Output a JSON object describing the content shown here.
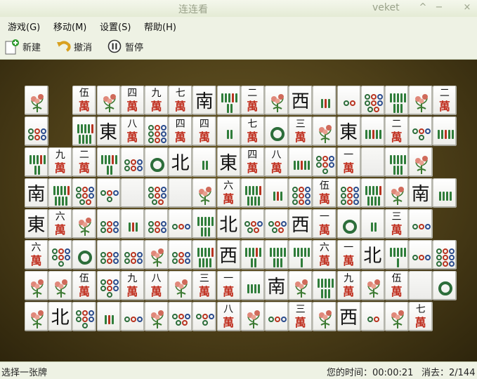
{
  "window": {
    "title": "连连看",
    "app": "veket",
    "buttons": [
      "^",
      "−",
      "×"
    ]
  },
  "menu": [
    "游戏(G)",
    "移动(M)",
    "设置(S)",
    "帮助(H)"
  ],
  "toolbar": {
    "new": "新建",
    "undo": "撤消",
    "pause": "暂停"
  },
  "status": {
    "hint": "选择一张牌",
    "time_label": "您的时间：00:00:21",
    "removed_label": "消去：2/144"
  },
  "colors": {
    "wan": "#c03020",
    "green": "#2f7d3a",
    "blue": "#2a4b8c"
  },
  "board": {
    "rows": [
      [
        "F:春",
        null,
        "W:伍",
        "F:夏",
        "W:四",
        "W:九",
        "W:七",
        "H:南",
        "B:7",
        "W:二",
        "F:春",
        "H:西",
        "B:3",
        "D:2",
        "D:8",
        "B:8",
        "F:秋",
        "W:二"
      ],
      [
        "D:6",
        null,
        "B:9",
        "H:東",
        "W:八",
        "D:9",
        "W:四",
        "W:四",
        "B:2",
        "W:七",
        "D:1",
        "W:三",
        "F:冬",
        "H:東",
        "B:5",
        "W:二",
        "D:4",
        "B:5"
      ],
      [
        "B:7",
        "W:九",
        "W:二",
        "B:7",
        "D:6",
        "D:1",
        "H:北",
        "B:2",
        "H:東",
        "W:四",
        "W:八",
        "B:5",
        "D:7",
        "W:一",
        "E:",
        "B:8",
        "F:秋",
        null
      ],
      [
        "H:南",
        "B:9",
        "D:8",
        "D:4",
        "E:",
        "D:8",
        "E:",
        "F:秋",
        "W:六",
        "B:9",
        "B:3",
        "D:9",
        "W:伍",
        "D:9",
        "B:9",
        "F:冬",
        "H:南",
        "B:4"
      ],
      [
        "H:東",
        "W:六",
        "F:冬",
        "D:6",
        "B:3",
        "D:6",
        "D:3",
        "B:8",
        "H:北",
        "D:5",
        "D:5",
        "H:西",
        "W:一",
        "D:1",
        "B:2",
        "W:三",
        "D:3",
        null
      ],
      [
        "W:六",
        "D:7",
        "D:1",
        "D:6",
        "D:6",
        "F:竹",
        "D:6",
        "B:9",
        "H:西",
        "B:7",
        "B:8",
        "B:6",
        "W:六",
        "W:一",
        "H:北",
        "B:6",
        "D:3",
        "D:9"
      ],
      [
        "F:竹",
        "F:冬",
        "W:伍",
        "D:7",
        "W:九",
        "W:八",
        "F:竹",
        "W:三",
        "W:一",
        "B:4",
        "H:南",
        "F:春",
        "B:8",
        "W:九",
        "F:春",
        "W:伍",
        "E:",
        "D:1"
      ],
      [
        "F:夏",
        "H:北",
        "D:7",
        "B:3",
        "D:3",
        "F:竹",
        "D:5",
        "D:4",
        "W:八",
        "F:春",
        "D:3",
        "W:三",
        "F:夏",
        "H:西",
        "D:2",
        "F:春",
        "W:七",
        null
      ]
    ]
  }
}
